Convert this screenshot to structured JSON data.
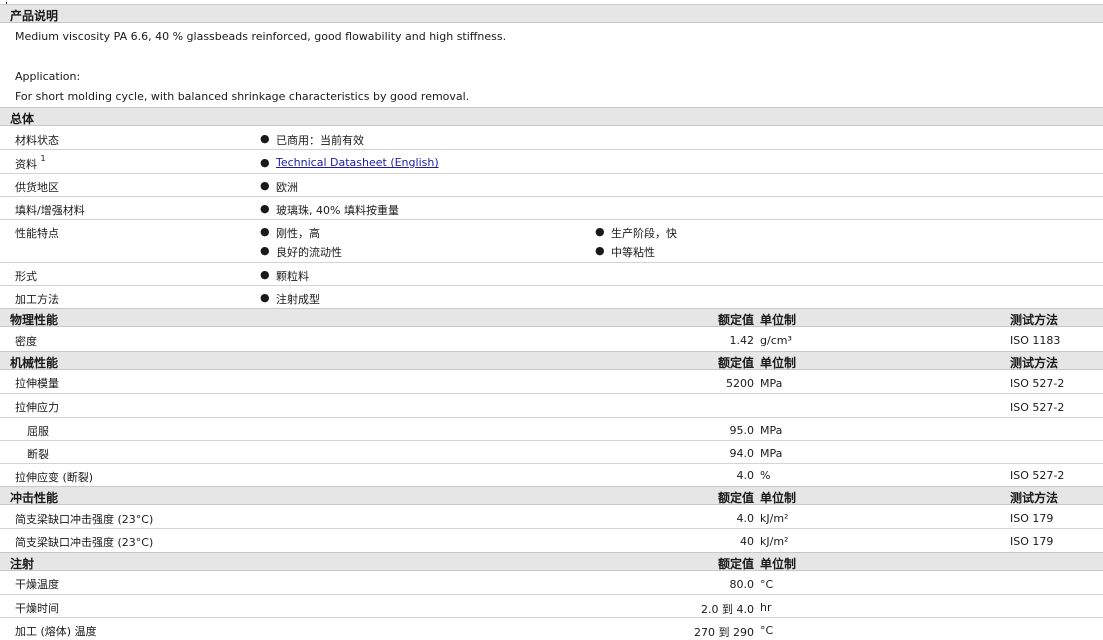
{
  "sections": {
    "desc": {
      "title": "产品说明"
    },
    "general": {
      "title": "总体"
    },
    "physical": {
      "title": "物理性能",
      "col1": "额定值",
      "col2": "单位制",
      "col3": "测试方法"
    },
    "mechanical": {
      "title": "机械性能",
      "col1": "额定值",
      "col2": "单位制",
      "col3": "测试方法"
    },
    "impact": {
      "title": "冲击性能",
      "col1": "额定值",
      "col2": "单位制",
      "col3": "测试方法"
    },
    "injection": {
      "title": "注射",
      "col1": "额定值",
      "col2": "单位制"
    }
  },
  "description": {
    "line1": "Medium viscosity PA 6.6, 40 % glassbeads reinforced, good flowability and high stiffness.",
    "line2": "Application:",
    "line3": "For short molding cycle, with balanced shrinkage characteristics by good removal."
  },
  "general": {
    "status_label": "材料状态",
    "status_value": "已商用：当前有效",
    "docs_label": "资料",
    "docs_sup": "1",
    "docs_link": "Technical Datasheet (English)",
    "region_label": "供货地区",
    "region_value": "欧洲",
    "filler_label": "填料/增强材料",
    "filler_value": "玻璃珠, 40% 填料按重量",
    "features_label": "性能特点",
    "features": [
      "刚性，高",
      "生产阶段，快",
      "良好的流动性",
      "中等粘性"
    ],
    "form_label": "形式",
    "form_value": "颗粒料",
    "process_label": "加工方法",
    "process_value": "注射成型"
  },
  "physical": {
    "density": {
      "label": "密度",
      "value": "1.42",
      "unit": "g/cm³",
      "method": "ISO 1183"
    }
  },
  "mechanical": {
    "modulus": {
      "label": "拉伸模量",
      "value": "5200",
      "unit": "MPa",
      "method": "ISO 527-2"
    },
    "stress": {
      "label": "拉伸应力",
      "method": "ISO 527-2"
    },
    "yield": {
      "label": "屈服",
      "value": "95.0",
      "unit": "MPa"
    },
    "break": {
      "label": "断裂",
      "value": "94.0",
      "unit": "MPa"
    },
    "strain": {
      "label": "拉伸应变 (断裂)",
      "value": "4.0",
      "unit": "%",
      "method": "ISO 527-2"
    }
  },
  "impact": {
    "r1": {
      "label": "简支梁缺口冲击强度 (23°C)",
      "value": "4.0",
      "unit": "kJ/m²",
      "method": "ISO 179"
    },
    "r2": {
      "label": "简支梁缺口冲击强度 (23°C)",
      "value": "40",
      "unit": "kJ/m²",
      "method": "ISO 179"
    }
  },
  "injection": {
    "dry_temp": {
      "label": "干燥温度",
      "value": "80.0",
      "unit": "°C"
    },
    "dry_time": {
      "label": "干燥时间",
      "value": "2.0 到  4.0",
      "unit": "hr"
    },
    "melt_temp": {
      "label": "加工 (熔体) 温度",
      "value": "270 到  290",
      "unit": "°C"
    }
  }
}
